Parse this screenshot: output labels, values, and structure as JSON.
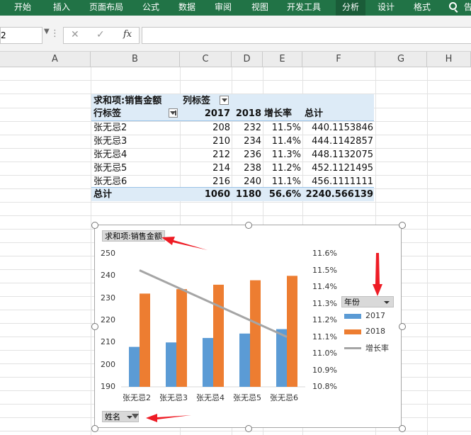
{
  "ribbon": {
    "tabs": [
      "开始",
      "插入",
      "页面布局",
      "公式",
      "数据",
      "审阅",
      "视图",
      "开发工具",
      "分析",
      "设计",
      "格式"
    ],
    "tell_me_glyph": "告"
  },
  "formula_bar": {
    "name_box": "2",
    "dots": "⋮"
  },
  "columns": [
    "A",
    "B",
    "C",
    "D",
    "E",
    "F",
    "G",
    "H"
  ],
  "pivot": {
    "title": "求和项:销售金额",
    "col_label": "列标签",
    "row_label": "行标签",
    "headers": [
      "2017",
      "2018",
      "增长率",
      "总计"
    ],
    "rows": [
      {
        "name": "张无忌2",
        "v2017": "208",
        "v2018": "232",
        "rate": "11.5%",
        "total": "440.1153846"
      },
      {
        "name": "张无忌3",
        "v2017": "210",
        "v2018": "234",
        "rate": "11.4%",
        "total": "444.1142857"
      },
      {
        "name": "张无忌4",
        "v2017": "212",
        "v2018": "236",
        "rate": "11.3%",
        "total": "448.1132075"
      },
      {
        "name": "张无忌5",
        "v2017": "214",
        "v2018": "238",
        "rate": "11.2%",
        "total": "452.1121495"
      },
      {
        "name": "张无忌6",
        "v2017": "216",
        "v2018": "240",
        "rate": "11.1%",
        "total": "456.1111111"
      }
    ],
    "grand": {
      "name": "总计",
      "v2017": "1060",
      "v2018": "1180",
      "rate": "56.6%",
      "total": "2240.566139"
    }
  },
  "chart_data": {
    "type": "bar",
    "value_button": "求和项:销售金额",
    "legend_button": "年份",
    "axis_button": "姓名",
    "categories": [
      "张无忌2",
      "张无忌3",
      "张无忌4",
      "张无忌5",
      "张无忌6"
    ],
    "series": [
      {
        "name": "2017",
        "values": [
          208,
          210,
          212,
          214,
          216
        ],
        "color": "#5b9bd5",
        "kind": "bar"
      },
      {
        "name": "2018",
        "values": [
          232,
          234,
          236,
          238,
          240
        ],
        "color": "#ed7d31",
        "kind": "bar"
      },
      {
        "name": "增长率",
        "values": [
          11.5,
          11.4,
          11.3,
          11.2,
          11.1
        ],
        "color": "#a5a5a5",
        "kind": "line",
        "axis": "secondary"
      }
    ],
    "ylim": [
      190,
      250
    ],
    "yticks": [
      "250",
      "240",
      "230",
      "220",
      "210",
      "200",
      "190"
    ],
    "y2lim": [
      10.8,
      11.6
    ],
    "y2ticks": [
      "11.6%",
      "11.5%",
      "11.4%",
      "11.3%",
      "11.2%",
      "11.1%",
      "11.0%",
      "10.9%",
      "10.8%"
    ],
    "legend_position": "right",
    "grid": false
  },
  "annotations": {
    "arrow_color": "#ee1c25"
  }
}
